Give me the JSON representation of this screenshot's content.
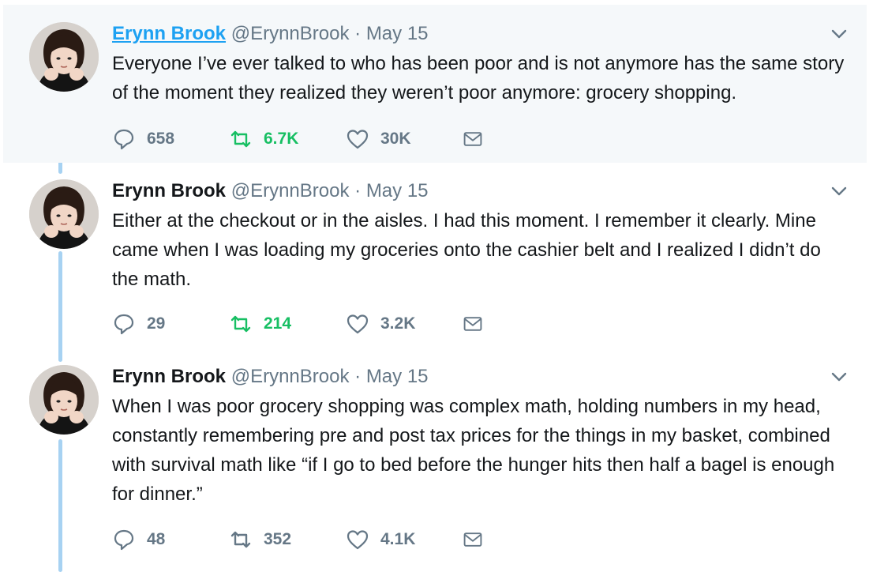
{
  "tweets": [
    {
      "name": "Erynn Brook",
      "handle": "@ErynnBrook",
      "separator": "·",
      "date": "May 15",
      "text": "Everyone I’ve ever talked to who has been poor and is not anymore has the same story of the moment they realized they weren’t poor anymore: grocery shopping.",
      "replies": "658",
      "retweets": "6.7K",
      "likes": "30K"
    },
    {
      "name": "Erynn Brook",
      "handle": "@ErynnBrook",
      "separator": "·",
      "date": "May 15",
      "text": "Either at the checkout or in the aisles. I had this moment. I remember it clearly. Mine came when I was loading my groceries onto the cashier belt and I realized I didn’t do the math.",
      "replies": "29",
      "retweets": "214",
      "likes": "3.2K"
    },
    {
      "name": "Erynn Brook",
      "handle": "@ErynnBrook",
      "separator": "·",
      "date": "May 15",
      "text": "When I was poor grocery shopping was complex math, holding numbers in my head, constantly remembering pre and post tax prices for the things in my basket, combined with survival math like “if I go to bed before the hunger hits then half a bagel is enough for dinner.”",
      "replies": "48",
      "retweets": "352",
      "likes": "4.1K"
    }
  ],
  "colors": {
    "link": "#1da1f2",
    "muted": "#657786",
    "retweet_active": "#17bf63",
    "thread_line": "#a7d2f2",
    "highlight_bg": "#f5f8fa"
  },
  "icons": [
    "avatar",
    "caret-down-icon",
    "reply-icon",
    "retweet-icon",
    "like-icon",
    "dm-icon"
  ]
}
